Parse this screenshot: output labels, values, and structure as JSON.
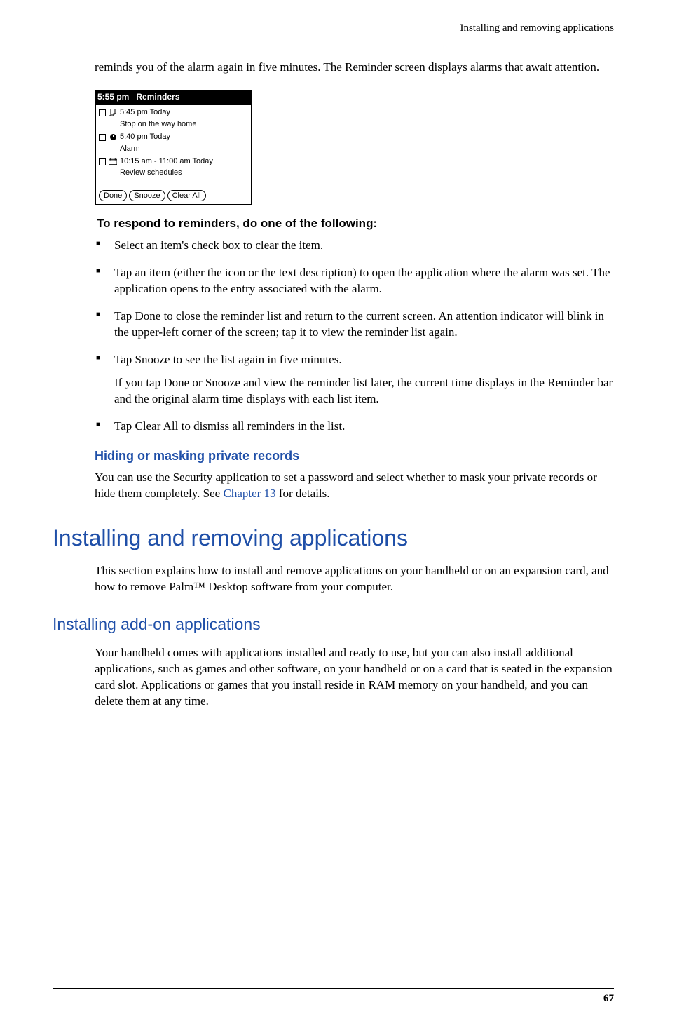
{
  "header": {
    "running_title": "Installing and removing applications"
  },
  "intro": "reminds you of the alarm again in five minutes. The Reminder screen displays alarms that await attention.",
  "screenshot": {
    "time": "5:55 pm",
    "title": "Reminders",
    "items": [
      {
        "time": "5:45 pm Today",
        "desc": "Stop on the way home"
      },
      {
        "time": "5:40 pm Today",
        "desc": "Alarm"
      },
      {
        "time": "10:15 am - 11:00 am Today",
        "desc": "Review schedules"
      }
    ],
    "buttons": {
      "done": "Done",
      "snooze": "Snooze",
      "clear": "Clear All"
    }
  },
  "task_heading": "To respond to reminders, do one of the following:",
  "bullets": [
    {
      "text": "Select an item's check box to clear the item."
    },
    {
      "text": "Tap an item (either the icon or the text description) to open the application where the alarm was set. The application opens to the entry associated with the alarm."
    },
    {
      "text": "Tap Done to close the reminder list and return to the current screen. An attention indicator will blink in the upper-left corner of the screen; tap it to view the reminder list again."
    },
    {
      "text": "Tap Snooze to see the list again in five minutes.",
      "sub": "If you tap Done or Snooze and view the reminder list later, the current time displays in the Reminder bar and the original alarm time displays with each list item."
    },
    {
      "text": "Tap Clear All to dismiss all reminders in the list."
    }
  ],
  "hiding": {
    "heading": "Hiding or masking private records",
    "text_before": "You can use the Security application to set a password and select whether to mask your private records or hide them completely. See ",
    "link": "Chapter 13",
    "text_after": " for details."
  },
  "h1": "Installing and removing applications",
  "section_intro": "This section explains how to install and remove applications on your handheld or on an expansion card, and how to remove Palm™ Desktop software from your computer.",
  "h2": "Installing add-on applications",
  "addon_text": "Your handheld comes with applications installed and ready to use, but you can also install additional applications, such as games and other software, on your handheld or on a card that is seated in the expansion card slot. Applications or games that you install reside in RAM memory on your handheld, and you can delete them at any time.",
  "page_number": "67"
}
